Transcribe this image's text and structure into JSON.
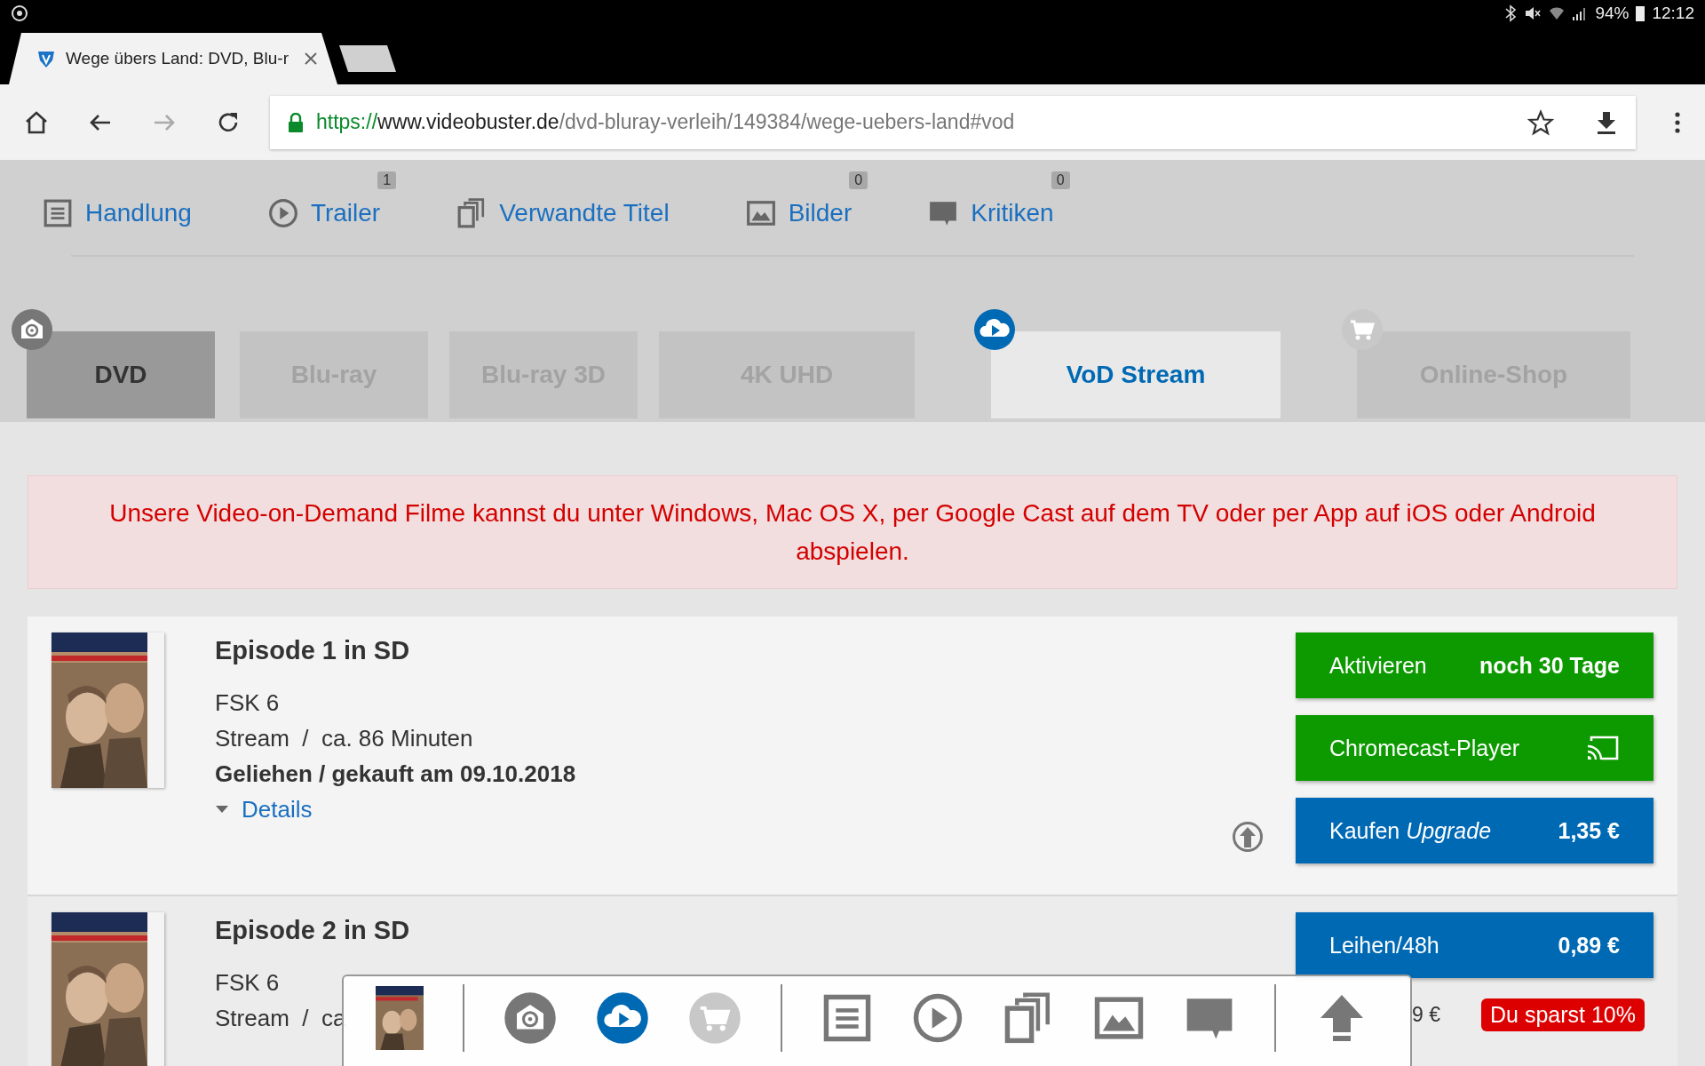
{
  "status_bar": {
    "battery": "94%",
    "time": "12:12"
  },
  "browser": {
    "tab_title": "Wege übers Land: DVD, Blu-r",
    "url_scheme": "https://",
    "url_host": "www.videobuster.de",
    "url_path": "/dvd-bluray-verleih/149384/wege-uebers-land#vod"
  },
  "nav_links": [
    {
      "kind": "plot",
      "label": "Handlung"
    },
    {
      "kind": "trailer",
      "label": "Trailer",
      "badge": "1"
    },
    {
      "kind": "related",
      "label": "Verwandte Titel"
    },
    {
      "kind": "images",
      "label": "Bilder",
      "badge": "0"
    },
    {
      "kind": "reviews",
      "label": "Kritiken",
      "badge": "0"
    }
  ],
  "format_tabs": [
    {
      "kind": "rental",
      "label": "DVD",
      "selected": false,
      "disabled": false
    },
    {
      "kind": "plain",
      "label": "Blu-ray",
      "selected": false,
      "disabled": true
    },
    {
      "kind": "plain",
      "label": "Blu-ray 3D",
      "selected": false,
      "disabled": true
    },
    {
      "kind": "plain",
      "label": "4K UHD",
      "selected": false,
      "disabled": true
    },
    {
      "kind": "stream",
      "label": "VoD Stream",
      "selected": true,
      "disabled": false
    },
    {
      "kind": "shop",
      "label": "Online-Shop",
      "selected": false,
      "disabled": true
    }
  ],
  "notice": "Unsere Video-on-Demand Filme kannst du unter Windows, Mac OS X, per Google Cast auf dem TV oder per App auf iOS oder Android abspielen.",
  "episodes": [
    {
      "title": "Episode 1 in SD",
      "rating": "FSK 6",
      "stream": "Stream  /  ca. 86 Minuten",
      "status": "Geliehen / gekauft am 09.10.2018",
      "details": "Details",
      "actions": [
        {
          "kind": "activate",
          "label": "Aktivieren",
          "value": "noch 30 Tage",
          "color": "#0c9a00"
        },
        {
          "kind": "cast",
          "label": "Chromecast-Player",
          "color": "#0c9a00"
        },
        {
          "kind": "upgrade",
          "label": "Kaufen *Upgrade*",
          "value": "1,35 €",
          "color": "#0069b4"
        }
      ]
    },
    {
      "title": "Episode 2 in SD",
      "rating": "FSK 6",
      "stream": "Stream  /  ca",
      "regular_price": "9 €",
      "discount": "Du sparst 10%",
      "actions": [
        {
          "kind": "rent",
          "label": "Leihen/48h",
          "value": "0,89 €",
          "color": "#0069b4"
        }
      ]
    }
  ]
}
